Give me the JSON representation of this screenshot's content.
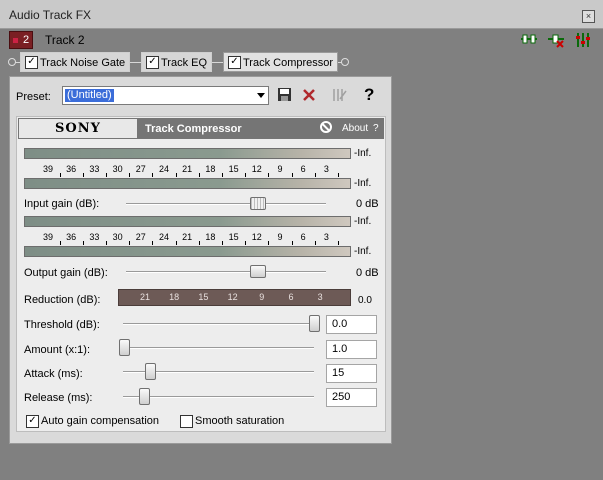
{
  "window": {
    "title": "Audio Track FX",
    "close_label": "×"
  },
  "track": {
    "number": "2",
    "name": "Track 2",
    "icons": [
      "plugin-chain-icon",
      "remove-plugin-icon",
      "mixer-icon"
    ]
  },
  "chain": {
    "tabs": [
      {
        "label": "Track Noise Gate",
        "checked": true,
        "active": false
      },
      {
        "label": "Track EQ",
        "checked": true,
        "active": false
      },
      {
        "label": "Track Compressor",
        "checked": true,
        "active": true
      }
    ]
  },
  "preset": {
    "label": "Preset:",
    "value": "(Untitled)"
  },
  "toolbar": {
    "icons": [
      "save-icon",
      "delete-icon",
      "bypass-icon",
      "help-icon"
    ],
    "help_label": "?"
  },
  "plugin": {
    "brand": "SONY",
    "title": "Track Compressor",
    "about_label": "About",
    "help_label": "?"
  },
  "meters": {
    "scale": [
      "39",
      "36",
      "33",
      "30",
      "27",
      "24",
      "21",
      "18",
      "15",
      "12",
      "9",
      "6",
      "3"
    ],
    "input_top_label": "-Inf.",
    "input_bottom_label": "-Inf.",
    "output_top_label": "-Inf.",
    "output_bottom_label": "-Inf."
  },
  "input_gain": {
    "label": "Input gain (dB):",
    "value": "0 dB"
  },
  "output_gain": {
    "label": "Output gain (dB):",
    "value": "0 dB"
  },
  "reduction": {
    "label": "Reduction (dB):",
    "scale": [
      "21",
      "18",
      "15",
      "12",
      "9",
      "6",
      "3"
    ],
    "value": "0.0"
  },
  "params": [
    {
      "label": "Threshold (dB):",
      "value": "0.0"
    },
    {
      "label": "Amount (x:1):",
      "value": "1.0"
    },
    {
      "label": "Attack (ms):",
      "value": "15"
    },
    {
      "label": "Release (ms):",
      "value": "250"
    }
  ],
  "options": {
    "auto_gain": {
      "label": "Auto gain compensation",
      "checked": true
    },
    "smooth_saturation": {
      "label": "Smooth saturation",
      "checked": false
    }
  },
  "colors": {
    "track_badge": "#7a1f23",
    "selection": "#3b6dd9",
    "header": "#757575",
    "reduction_bar": "#6d5a56"
  }
}
